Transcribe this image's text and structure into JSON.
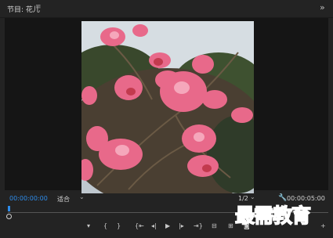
{
  "panel": {
    "title": "节目: 花儿",
    "menu_icon": "hamburger-icon",
    "expand_icon": "expand-icon"
  },
  "viewer": {
    "image": "pink-azalea-flowers"
  },
  "controls": {
    "current_timecode": "00:00:00:00",
    "fit_label": "适合",
    "resolution_label": "1/2",
    "settings_icon": "wrench-icon",
    "duration_timecode": "00:00:05:00"
  },
  "transport": {
    "icons": [
      "add-marker-icon",
      "mark-in-icon",
      "mark-out-icon",
      "go-to-in-icon",
      "step-back-icon",
      "play-icon",
      "step-forward-icon",
      "go-to-out-icon",
      "insert-icon",
      "overwrite-icon",
      "export-frame-icon",
      "button-editor-icon"
    ]
  },
  "watermark": {
    "text": "最需教育"
  },
  "colors": {
    "accent": "#2d8ceb",
    "panel_bg": "#232323",
    "viewer_bg": "#151515"
  }
}
